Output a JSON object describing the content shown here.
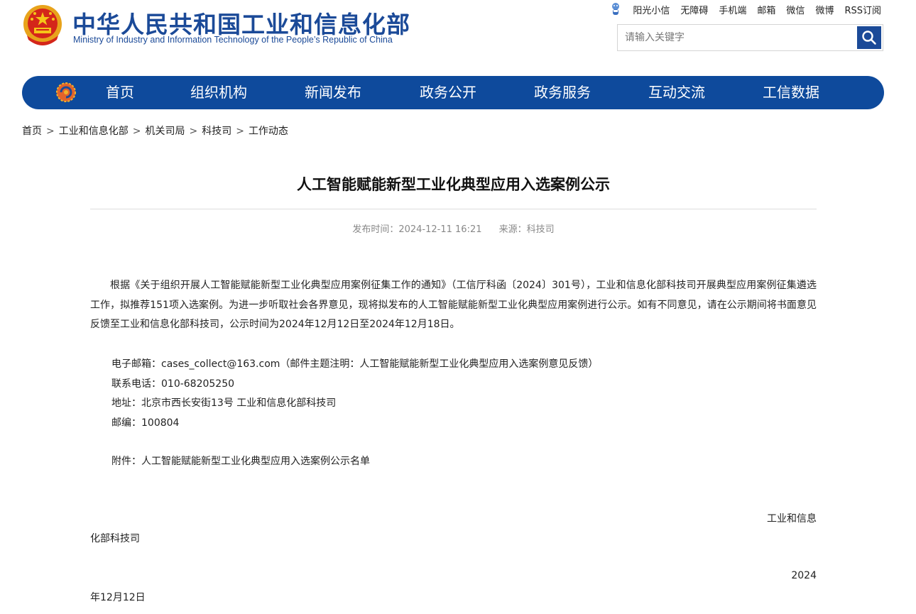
{
  "header": {
    "title_cn": "中华人民共和国工业和信息化部",
    "title_en": "Ministry of Industry and Information Technology of the People’s Republic of China",
    "top_links": [
      "阳光小信",
      "无障碍",
      "手机端",
      "邮箱",
      "微信",
      "微博",
      "RSS订阅"
    ],
    "search_placeholder": "请输入关键字"
  },
  "nav": {
    "items": [
      "首页",
      "组织机构",
      "新闻发布",
      "政务公开",
      "政务服务",
      "互动交流",
      "工信数据"
    ]
  },
  "breadcrumb": [
    "首页",
    "工业和信息化部",
    "机关司局",
    "科技司",
    "工作动态"
  ],
  "breadcrumb_sep": ">",
  "article": {
    "title": "人工智能赋能新型工业化典型应用入选案例公示",
    "publish_time": "发布时间：2024-12-11 16:21",
    "source": "来源：科技司",
    "body": "根据《关于组织开展人工智能赋能新型工业化典型应用案例征集工作的通知》（工信厅科函〔2024〕301号），工业和信息化部科技司开展典型应用案例征集遴选工作，拟推荐151项入选案例。为进一步听取社会各界意见，现将拟发布的人工智能赋能新型工业化典型应用案例进行公示。如有不同意见，请在公示期间将书面意见反馈至工业和信息化部科技司，公示时间为2024年12月12日至2024年12月18日。",
    "email": "电子邮箱：cases_collect@163.com（邮件主题注明：人工智能赋能新型工业化典型应用入选案例意见反馈）",
    "phone": "联系电话：010-68205250",
    "address": "地址：北京市西长安街13号 工业和信息化部科技司",
    "postcode": "邮编：100804",
    "attachment": "附件：人工智能赋能新型工业化典型应用入选案例公示名单",
    "sign_part1": "工业和信息",
    "sign_part2": "化部科技司",
    "date_part1": "2024",
    "date_part2": "年12月12日"
  },
  "colors": {
    "brand_blue": "#1b4a98",
    "nav_blue": "#0e4a9c"
  }
}
